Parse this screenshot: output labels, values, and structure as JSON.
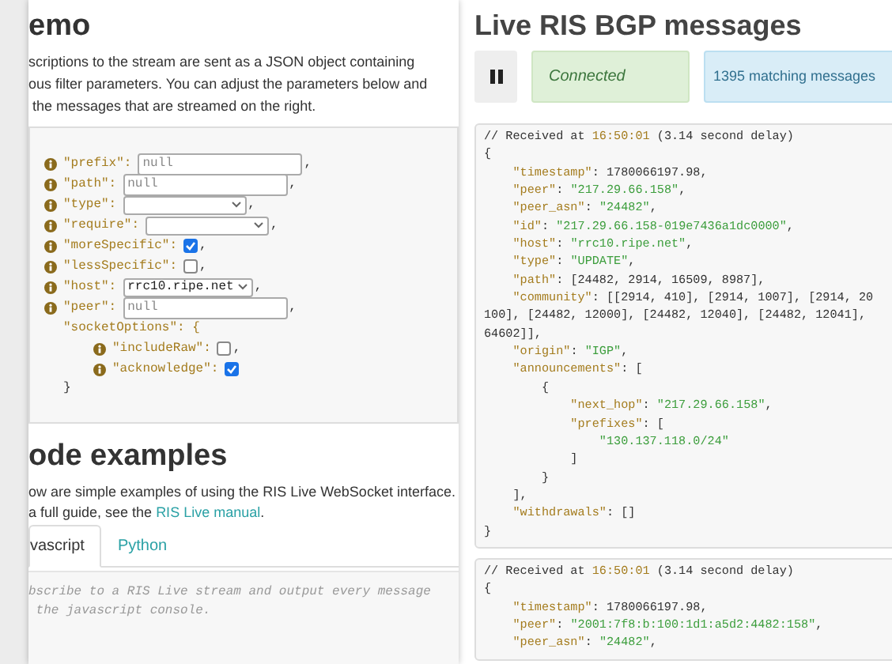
{
  "demo": {
    "heading": "emo",
    "intro_lines": [
      "scriptions to the stream are sent as a JSON object containing",
      "ous filter parameters. You can adjust the parameters below and",
      " the messages that are streamed on the right."
    ],
    "form": {
      "rows": [
        {
          "kind": "input",
          "key": "\"prefix\":",
          "placeholder": "null",
          "suffix": ","
        },
        {
          "kind": "input",
          "key": "\"path\":",
          "placeholder": "null",
          "suffix": ","
        },
        {
          "kind": "select",
          "key": "\"type\":",
          "suffix": ","
        },
        {
          "kind": "select",
          "key": "\"require\":",
          "suffix": ","
        },
        {
          "kind": "checkbox",
          "key": "\"moreSpecific\":",
          "checked": true,
          "suffix": ","
        },
        {
          "kind": "checkbox",
          "key": "\"lessSpecific\":",
          "checked": false,
          "suffix": ","
        },
        {
          "kind": "select",
          "key": "\"host\":",
          "value": "rrc10.ripe.net",
          "suffix": ","
        },
        {
          "kind": "input",
          "key": "\"peer\":",
          "placeholder": "null",
          "suffix": ","
        }
      ],
      "group": {
        "key": "\"socketOptions\"",
        "open": ": {",
        "close": "}",
        "rows": [
          {
            "kind": "checkbox",
            "key": "\"includeRaw\":",
            "checked": false,
            "suffix": ","
          },
          {
            "kind": "checkbox",
            "key": "\"acknowledge\":",
            "checked": true
          }
        ]
      }
    }
  },
  "examples": {
    "heading": "ode examples",
    "line_1": "ow are simple examples of using the RIS Live WebSocket interface.",
    "line_2": {
      "before": "a full guide, see the ",
      "link": "RIS Live manual",
      "after": "."
    },
    "tabs": [
      {
        "label": "vascript",
        "selected": true
      },
      {
        "label": "Python",
        "selected": false
      }
    ],
    "code_lines": [
      "bscribe to a RIS Live stream and output every message",
      " the javascript console."
    ]
  },
  "live": {
    "heading": "Live RIS BGP messages",
    "status": "Connected",
    "count": "1395 matching messages",
    "messages": [
      {
        "lines": [
          [
            {
              "kind": "plain",
              "text": "// Received at "
            },
            {
              "kind": "time",
              "text": "16:50:01"
            },
            {
              "kind": "plain",
              "text": " (3.14 second delay)"
            }
          ],
          [
            {
              "kind": "plain",
              "text": "{"
            }
          ],
          [
            {
              "kind": "key",
              "text": "    \"timestamp\""
            },
            {
              "kind": "plain",
              "text": ": 1780066197.98,"
            }
          ],
          [
            {
              "kind": "key",
              "text": "    \"peer\""
            },
            {
              "kind": "plain",
              "text": ": "
            },
            {
              "kind": "string",
              "text": "\"217.29.66.158\""
            },
            {
              "kind": "plain",
              "text": ","
            }
          ],
          [
            {
              "kind": "key",
              "text": "    \"peer_asn\""
            },
            {
              "kind": "plain",
              "text": ": "
            },
            {
              "kind": "string",
              "text": "\"24482\""
            },
            {
              "kind": "plain",
              "text": ","
            }
          ],
          [
            {
              "kind": "key",
              "text": "    \"id\""
            },
            {
              "kind": "plain",
              "text": ": "
            },
            {
              "kind": "string",
              "text": "\"217.29.66.158-019e7436a1dc0000\""
            },
            {
              "kind": "plain",
              "text": ","
            }
          ],
          [
            {
              "kind": "key",
              "text": "    \"host\""
            },
            {
              "kind": "plain",
              "text": ": "
            },
            {
              "kind": "string",
              "text": "\"rrc10.ripe.net\""
            },
            {
              "kind": "plain",
              "text": ","
            }
          ],
          [
            {
              "kind": "key",
              "text": "    \"type\""
            },
            {
              "kind": "plain",
              "text": ": "
            },
            {
              "kind": "string",
              "text": "\"UPDATE\""
            },
            {
              "kind": "plain",
              "text": ","
            }
          ],
          [
            {
              "kind": "key",
              "text": "    \"path\""
            },
            {
              "kind": "plain",
              "text": ": [24482, 2914, 16509, 8987],"
            }
          ],
          [
            {
              "kind": "key",
              "text": "    \"community\""
            },
            {
              "kind": "plain",
              "text": ": [[2914, 410], [2914, 1007], [2914, 20"
            }
          ],
          [
            {
              "kind": "plain",
              "text": "100], [24482, 12000], [24482, 12040], [24482, 12041],"
            }
          ],
          [
            {
              "kind": "plain",
              "text": "64602]],"
            }
          ],
          [
            {
              "kind": "key",
              "text": "    \"origin\""
            },
            {
              "kind": "plain",
              "text": ": "
            },
            {
              "kind": "string",
              "text": "\"IGP\""
            },
            {
              "kind": "plain",
              "text": ","
            }
          ],
          [
            {
              "kind": "key",
              "text": "    \"announcements\""
            },
            {
              "kind": "plain",
              "text": ": ["
            }
          ],
          [
            {
              "kind": "plain",
              "text": "        {"
            }
          ],
          [
            {
              "kind": "key",
              "text": "            \"next_hop\""
            },
            {
              "kind": "plain",
              "text": ": "
            },
            {
              "kind": "string",
              "text": "\"217.29.66.158\""
            },
            {
              "kind": "plain",
              "text": ","
            }
          ],
          [
            {
              "kind": "key",
              "text": "            \"prefixes\""
            },
            {
              "kind": "plain",
              "text": ": ["
            }
          ],
          [
            {
              "kind": "string",
              "text": "                \"130.137.118.0/24\""
            }
          ],
          [
            {
              "kind": "plain",
              "text": "            ]"
            }
          ],
          [
            {
              "kind": "plain",
              "text": "        }"
            }
          ],
          [
            {
              "kind": "plain",
              "text": "    ],"
            }
          ],
          [
            {
              "kind": "key",
              "text": "    \"withdrawals\""
            },
            {
              "kind": "plain",
              "text": ": []"
            }
          ],
          [
            {
              "kind": "plain",
              "text": "}"
            }
          ]
        ]
      },
      {
        "lines": [
          [
            {
              "kind": "plain",
              "text": "// Received at "
            },
            {
              "kind": "time",
              "text": "16:50:01"
            },
            {
              "kind": "plain",
              "text": " (3.14 second delay)"
            }
          ],
          [
            {
              "kind": "plain",
              "text": "{"
            }
          ],
          [
            {
              "kind": "key",
              "text": "    \"timestamp\""
            },
            {
              "kind": "plain",
              "text": ": 1780066197.98,"
            }
          ],
          [
            {
              "kind": "key",
              "text": "    \"peer\""
            },
            {
              "kind": "plain",
              "text": ": "
            },
            {
              "kind": "string",
              "text": "\"2001:7f8:b:100:1d1:a5d2:4482:158\""
            },
            {
              "kind": "plain",
              "text": ","
            }
          ],
          [
            {
              "kind": "key",
              "text": "    \"peer_asn\""
            },
            {
              "kind": "plain",
              "text": ": "
            },
            {
              "kind": "string",
              "text": "\"24482\""
            },
            {
              "kind": "plain",
              "text": ","
            }
          ]
        ]
      }
    ]
  }
}
